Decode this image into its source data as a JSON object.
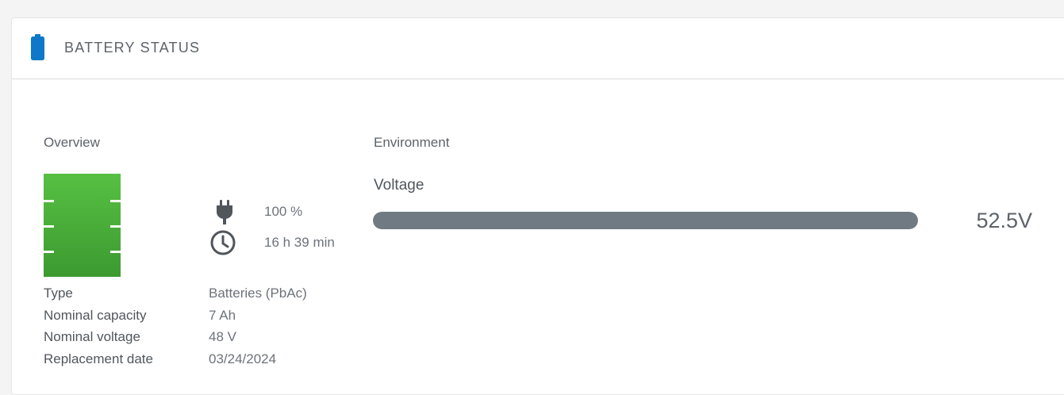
{
  "header": {
    "title": "BATTERY STATUS",
    "icon": "battery-icon",
    "accent_color": "#0f78c8"
  },
  "overview": {
    "label": "Overview",
    "battery_graphic_color": "#4db33d",
    "charge_icon": "plug-icon",
    "charge_level": "100 %",
    "runtime_icon": "clock-icon",
    "runtime": "16 h 39 min",
    "details": [
      {
        "label": "Type",
        "value": "Batteries (PbAc)"
      },
      {
        "label": "Nominal capacity",
        "value": "7 Ah"
      },
      {
        "label": "Nominal voltage",
        "value": "48 V"
      },
      {
        "label": "Replacement date",
        "value": "03/24/2024"
      }
    ]
  },
  "environment": {
    "label": "Environment",
    "voltage": {
      "label": "Voltage",
      "value": "52.5V",
      "fill_fraction": 1.0,
      "bar_color": "#6f7a82"
    }
  }
}
